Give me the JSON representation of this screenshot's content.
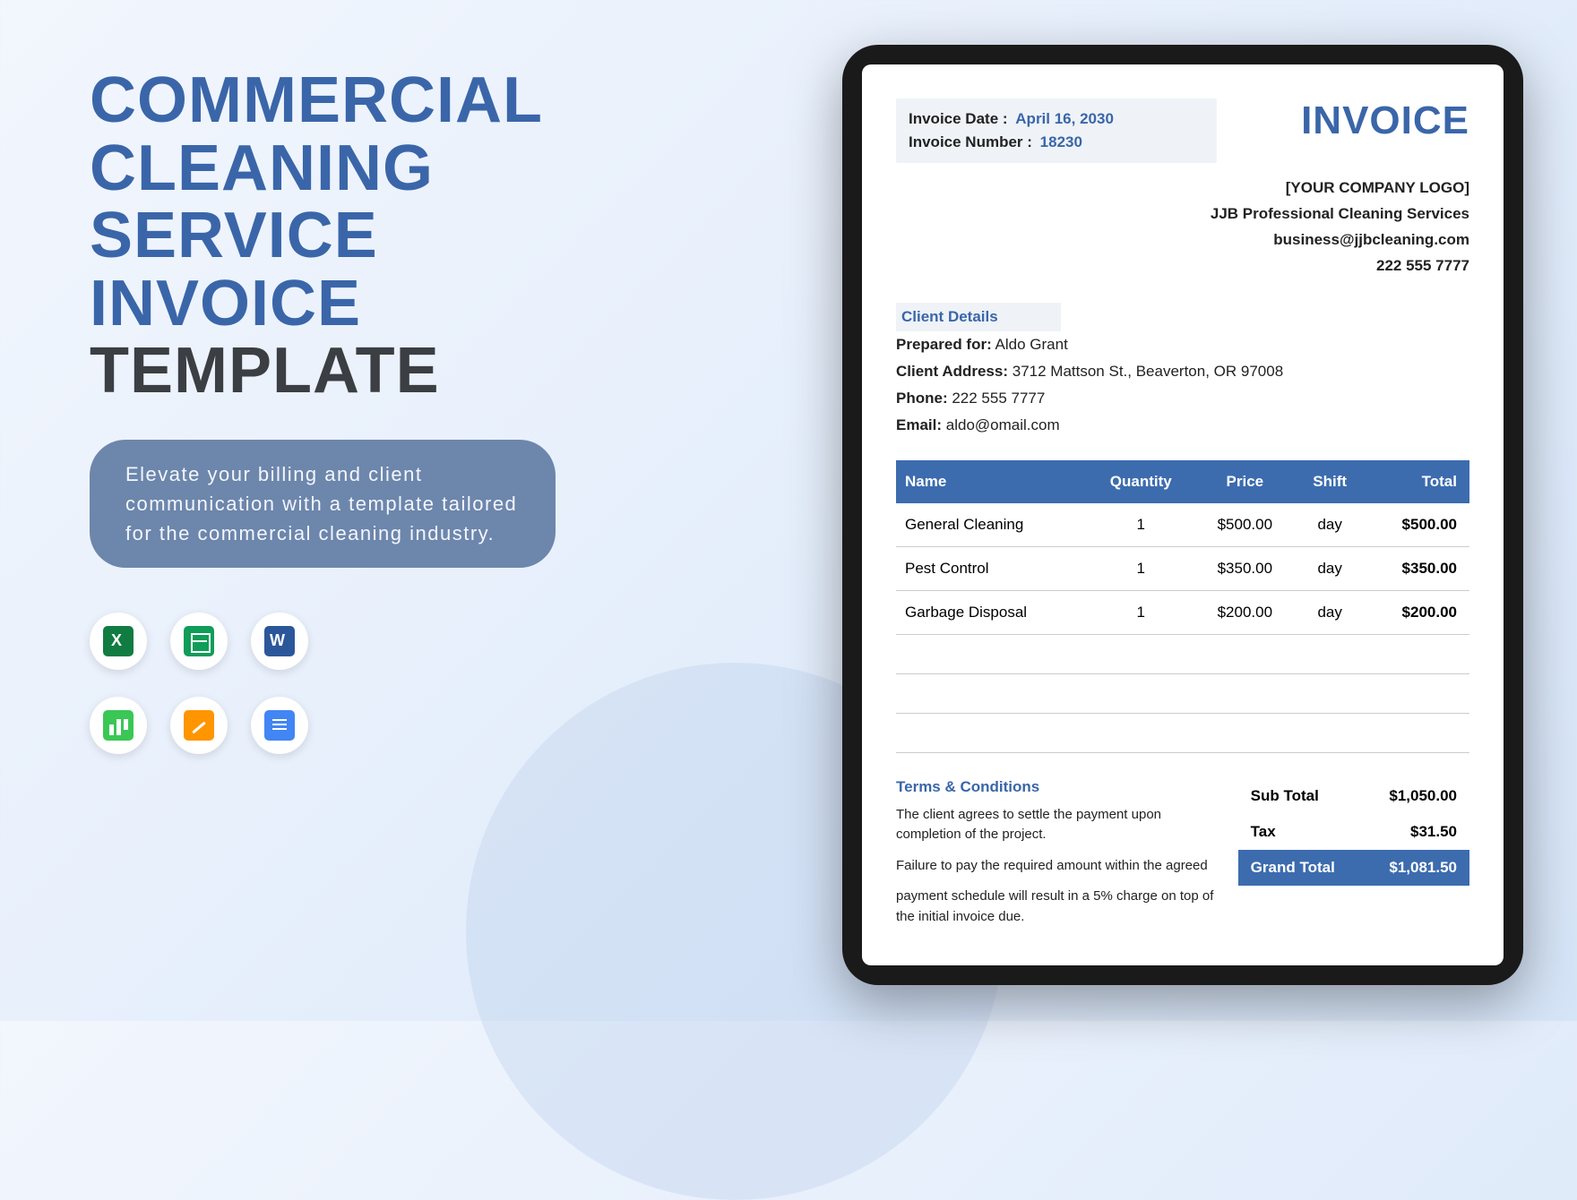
{
  "left": {
    "title_line1": "COMMERCIAL",
    "title_line2": "CLEANING",
    "title_line3": "SERVICE",
    "title_line4": "INVOICE",
    "title_line5": "TEMPLATE",
    "tagline": "Elevate your billing and client communication with a template tailored for the commercial cleaning industry."
  },
  "icons": [
    "excel-icon",
    "sheets-icon",
    "word-icon",
    "numbers-icon",
    "pages-icon",
    "docs-icon"
  ],
  "invoice": {
    "title": "INVOICE",
    "date_label": "Invoice Date :",
    "date_value": "April 16, 2030",
    "number_label": "Invoice Number :",
    "number_value": "18230",
    "company": {
      "logo": "[YOUR COMPANY LOGO]",
      "name": "JJB Professional Cleaning Services",
      "email": "business@jjbcleaning.com",
      "phone": "222 555 7777"
    },
    "client_heading": "Client Details",
    "client": {
      "prepared_label": "Prepared for:",
      "prepared_value": "Aldo Grant",
      "address_label": "Client Address:",
      "address_value": "3712 Mattson St., Beaverton, OR 97008",
      "phone_label": "Phone:",
      "phone_value": "222 555 7777",
      "email_label": "Email:",
      "email_value": "aldo@omail.com"
    },
    "table": {
      "headers": [
        "Name",
        "Quantity",
        "Price",
        "Shift",
        "Total"
      ],
      "rows": [
        {
          "name": "General Cleaning",
          "qty": "1",
          "price": "$500.00",
          "shift": "day",
          "total": "$500.00"
        },
        {
          "name": "Pest Control",
          "qty": "1",
          "price": "$350.00",
          "shift": "day",
          "total": "$350.00"
        },
        {
          "name": "Garbage Disposal",
          "qty": "1",
          "price": "$200.00",
          "shift": "day",
          "total": "$200.00"
        }
      ]
    },
    "terms": {
      "heading": "Terms & Conditions",
      "p1": "The client agrees to settle the payment upon completion of the project.",
      "p2": "Failure to pay the required amount within the agreed",
      "p3": "payment schedule will result in a 5% charge on top of the initial invoice due."
    },
    "totals": {
      "subtotal_label": "Sub Total",
      "subtotal_value": "$1,050.00",
      "tax_label": "Tax",
      "tax_value": "$31.50",
      "grand_label": "Grand Total",
      "grand_value": "$1,081.50"
    }
  }
}
